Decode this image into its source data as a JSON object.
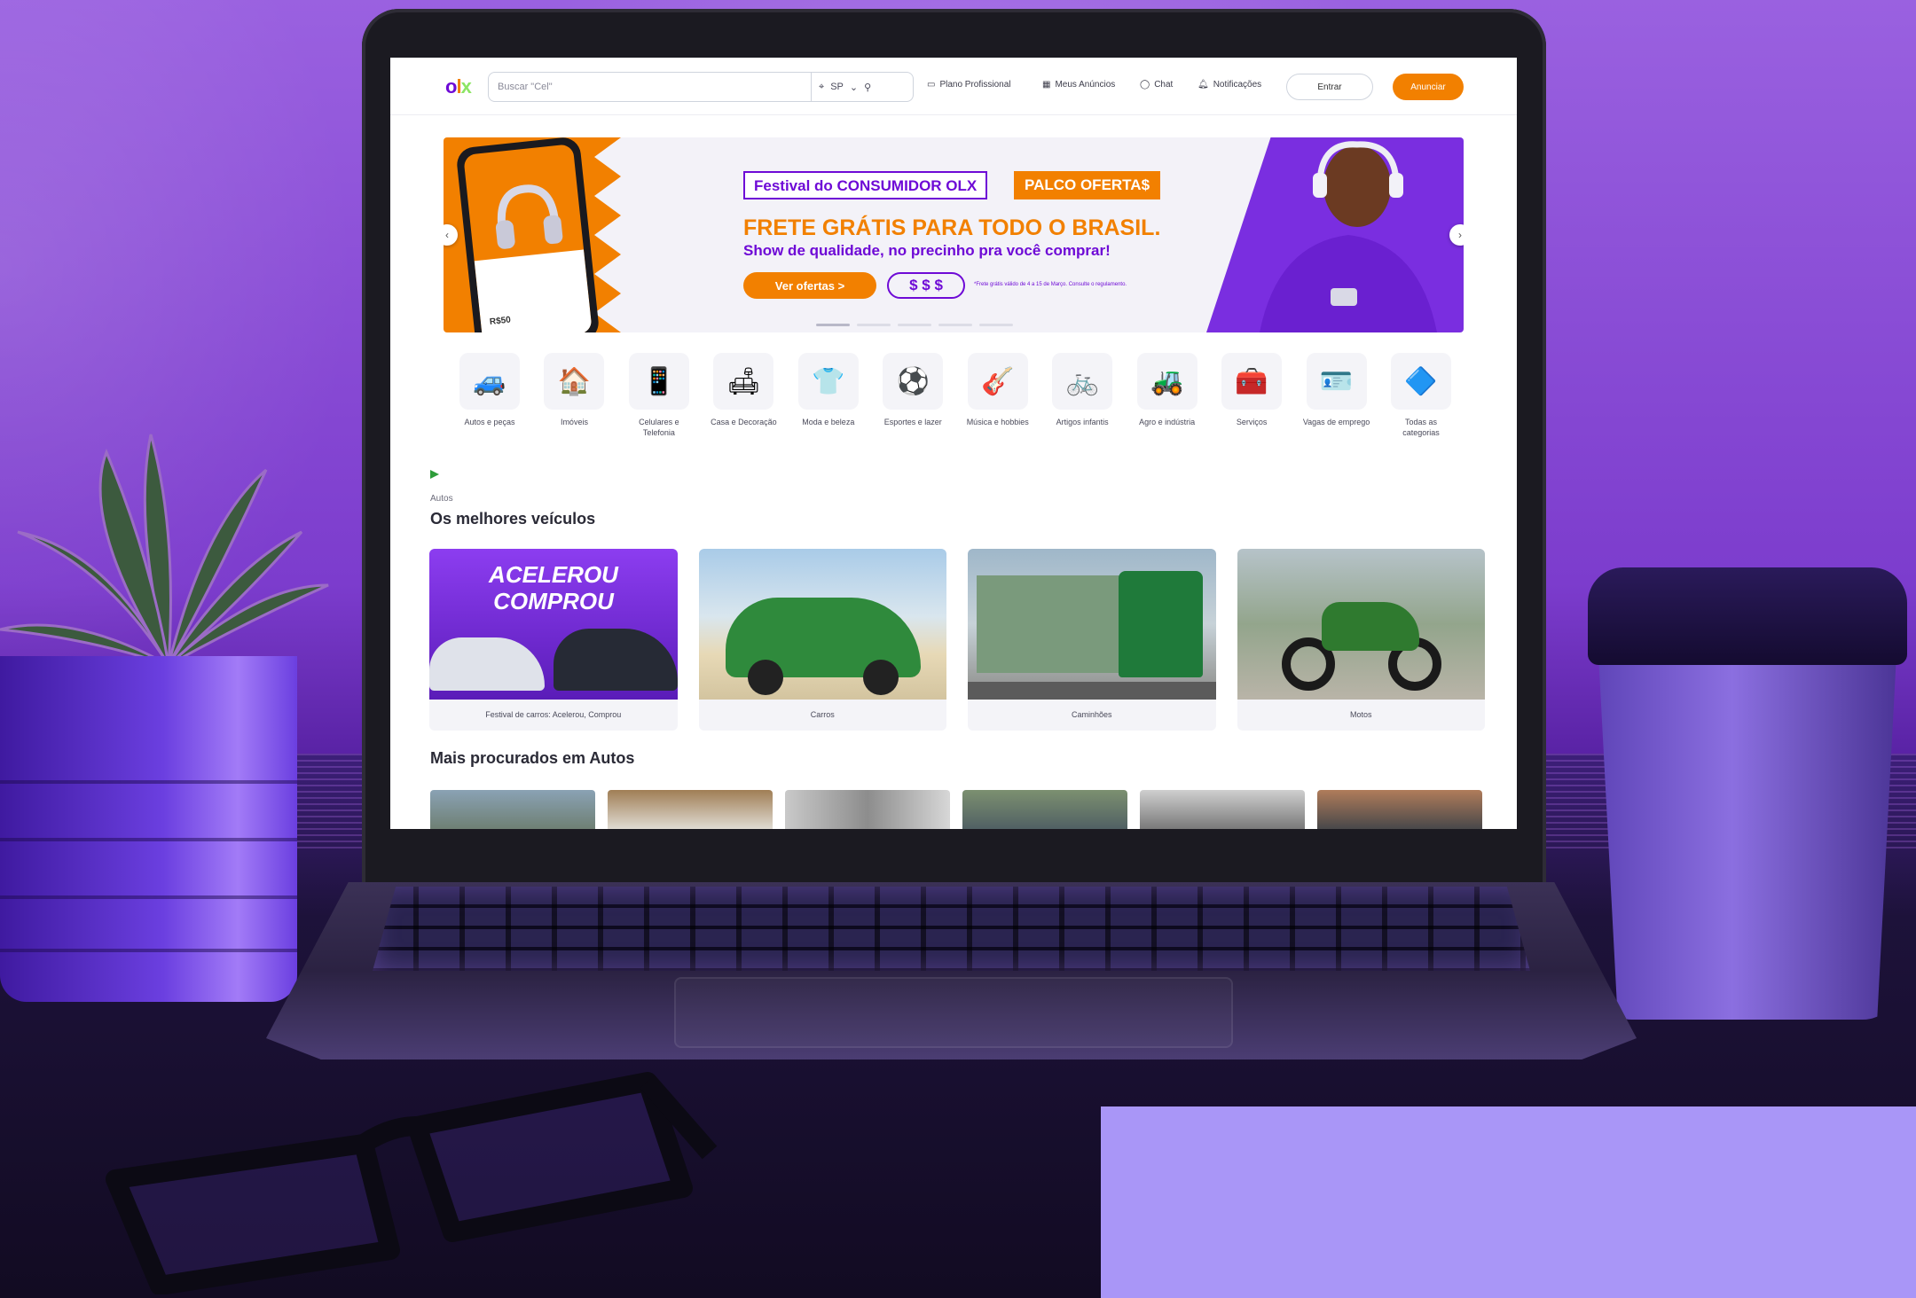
{
  "header": {
    "logo_o": "o",
    "logo_l": "l",
    "logo_x": "x",
    "search_placeholder": "Buscar \"Cel\"",
    "location": "SP",
    "nav": [
      "Plano Profissional",
      "Meus Anúncios",
      "Chat",
      "Notificações"
    ],
    "login": "Entrar",
    "announce": "Anunciar"
  },
  "banner": {
    "tag": "Festival do CONSUMIDOR OLX",
    "tag2": "PALCO OFERTA$",
    "headline": "FRETE GRÁTIS PARA TODO O BRASIL.",
    "subhead": "Show de qualidade, no precinho pra você comprar!",
    "cta": "Ver ofertas >",
    "money": "$ $ $",
    "fine_print": "*Frete grátis válido de 4 a 15 de Março. Consulte o regulamento.",
    "phone_price": "R$50",
    "slides": 5,
    "active_slide": 1
  },
  "categories": [
    {
      "label": "Autos e peças",
      "icon": "car-icon",
      "glyph": "🚙"
    },
    {
      "label": "Imóveis",
      "icon": "house-icon",
      "glyph": "🏠"
    },
    {
      "label": "Celulares e Telefonia",
      "icon": "phone-icon",
      "glyph": "📱"
    },
    {
      "label": "Casa e Decoração",
      "icon": "sofa-icon",
      "glyph": "🛋"
    },
    {
      "label": "Moda e beleza",
      "icon": "clothes-icon",
      "glyph": "👕"
    },
    {
      "label": "Esportes e lazer",
      "icon": "ball-icon",
      "glyph": "⚽"
    },
    {
      "label": "Música e hobbies",
      "icon": "guitar-icon",
      "glyph": "🎸"
    },
    {
      "label": "Artigos infantis",
      "icon": "tricycle-icon",
      "glyph": "🚲"
    },
    {
      "label": "Agro e indústria",
      "icon": "tractor-icon",
      "glyph": "🚜"
    },
    {
      "label": "Serviços",
      "icon": "tools-icon",
      "glyph": "🧰"
    },
    {
      "label": "Vagas de emprego",
      "icon": "badge-icon",
      "glyph": "🪪"
    },
    {
      "label": "Todas as categorias",
      "icon": "shapes-icon",
      "glyph": "🔷"
    }
  ],
  "section1": {
    "eyebrow": "Autos",
    "title": "Os melhores veículos",
    "cards": [
      {
        "label": "Festival de carros: Acelerou, Comprou",
        "promo": "ACELEROU COMPROU"
      },
      {
        "label": "Carros"
      },
      {
        "label": "Caminhões"
      },
      {
        "label": "Motos"
      }
    ]
  },
  "section2": {
    "title": "Mais procurados em Autos"
  },
  "colors": {
    "olx_purple": "#6e0ad6",
    "olx_orange": "#f28000",
    "olx_green": "#8ce563"
  }
}
